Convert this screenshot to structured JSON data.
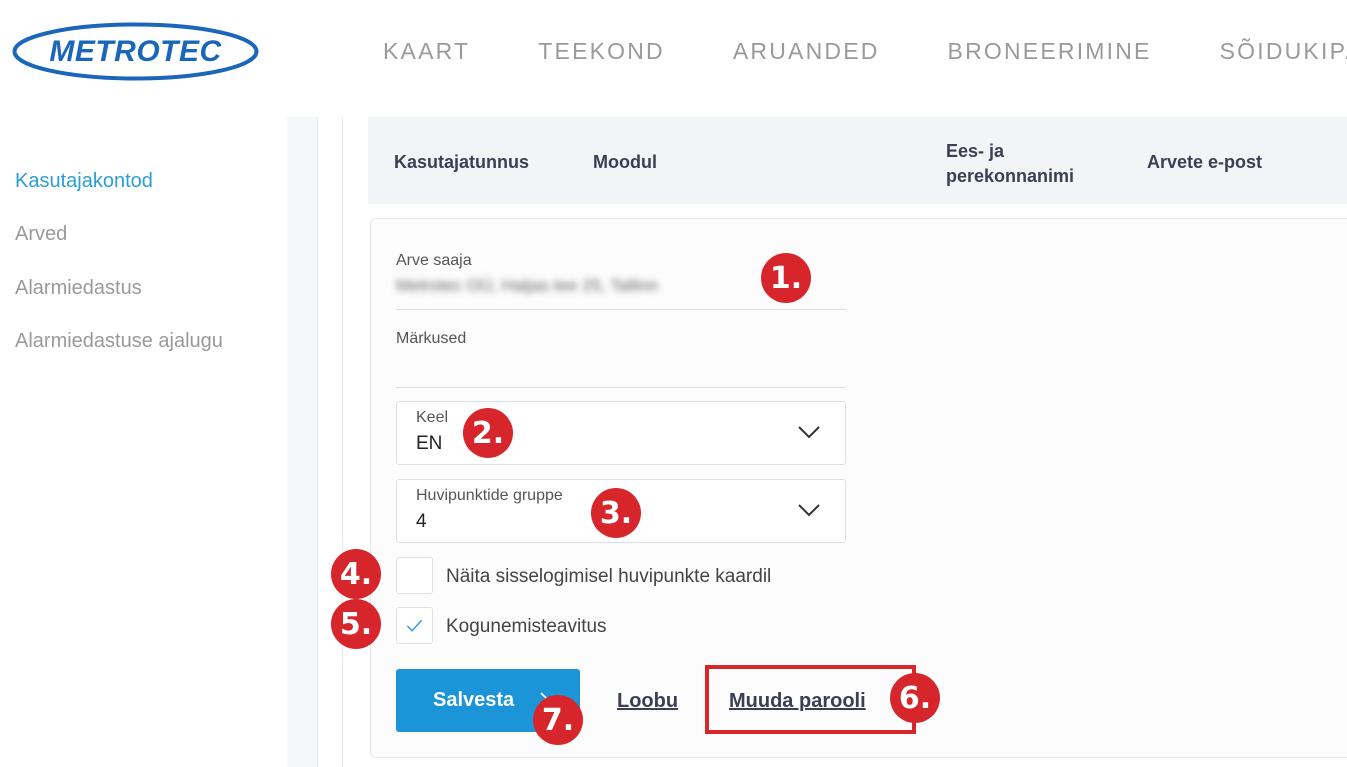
{
  "brand": {
    "logo_text": "METROTEC",
    "color": "#1a66b8"
  },
  "topnav": [
    "KAART",
    "TEEKOND",
    "ARUANDED",
    "BRONEERIMINE",
    "SÕIDUKIPARK"
  ],
  "sidebar": {
    "items": [
      {
        "label": "Kasutajakontod",
        "active": true
      },
      {
        "label": "Arved",
        "active": false
      },
      {
        "label": "Alarmiedastus",
        "active": false
      },
      {
        "label": "Alarmiedastuse ajalugu",
        "active": false
      }
    ]
  },
  "table": {
    "headers": [
      "Kasutajatunnus",
      "Moodul",
      "Ees- ja perekonnanimi",
      "Arvete e-post"
    ],
    "header_name_line1": "Ees- ja",
    "header_name_line2": "perekonnanimi"
  },
  "form": {
    "recipient_label": "Arve saaja",
    "recipient_value": "Metrotec OÜ, Haljas tee 25, Tallinn",
    "notes_label": "Märkused",
    "notes_value": "",
    "language": {
      "label": "Keel",
      "value": "EN"
    },
    "poi_group": {
      "label": "Huvipunktide gruppe",
      "value": "4"
    },
    "show_poi": {
      "label": "Näita sisselogimisel huvipunkte kaardil",
      "checked": false
    },
    "gathering_notice": {
      "label": "Kogunemisteavitus",
      "checked": true
    },
    "save_label": "Salvesta",
    "cancel_label": "Loobu",
    "change_password_label": "Muuda parooli"
  },
  "annotations": [
    "1.",
    "2.",
    "3.",
    "4.",
    "5.",
    "6.",
    "7."
  ],
  "colors": {
    "accent": "#1b95d8",
    "active_link": "#2b9ed6",
    "annotation": "#d6262c"
  }
}
